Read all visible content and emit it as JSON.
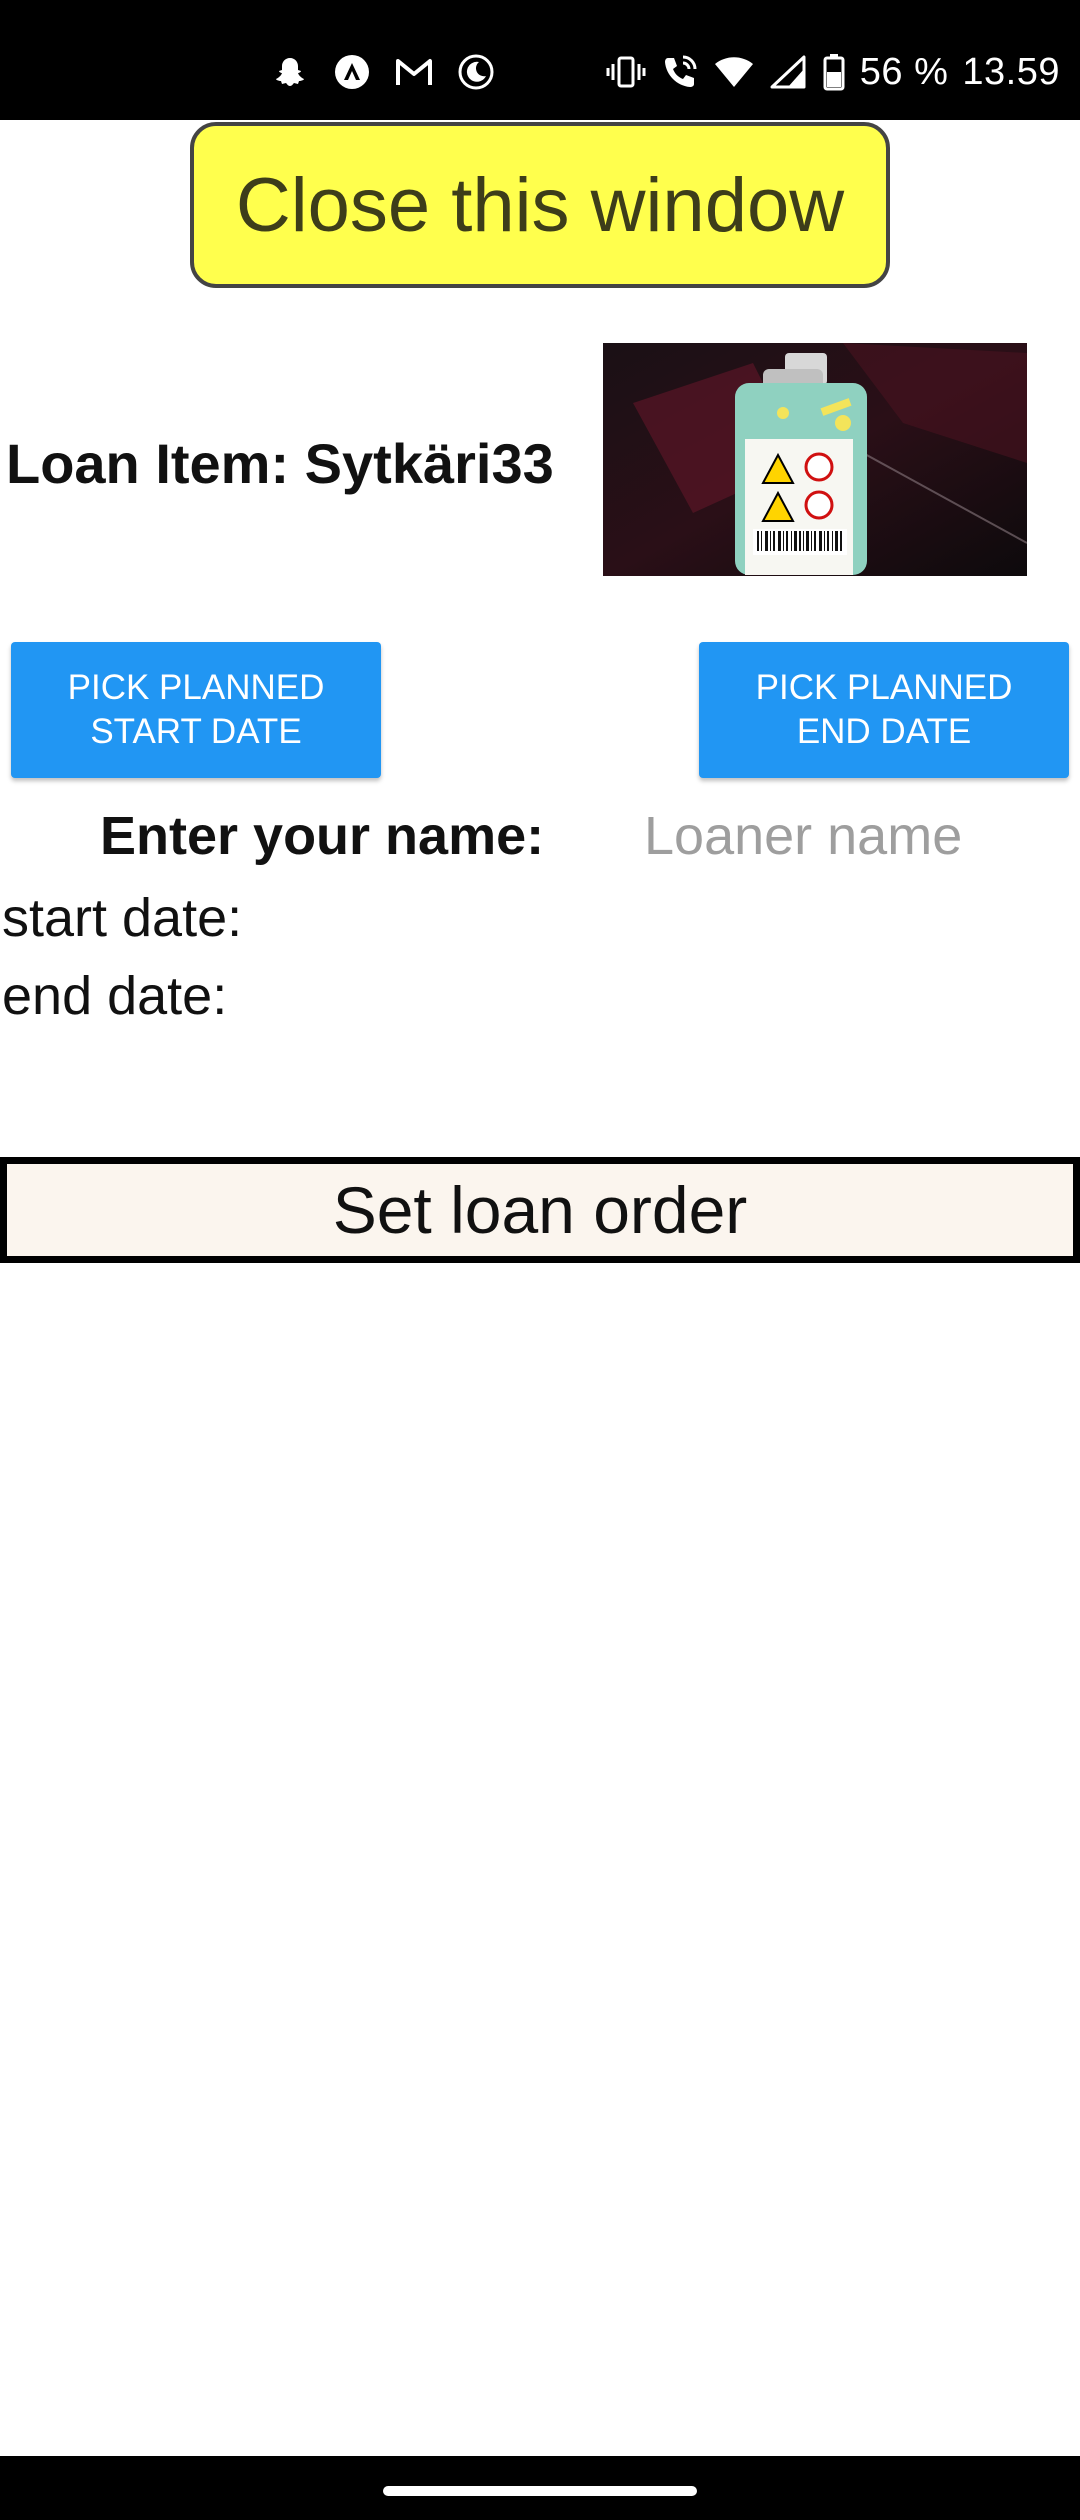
{
  "status_bar": {
    "left_icons": [
      "snapchat-icon",
      "arrow-up-circle-icon",
      "gmail-icon",
      "moon-icon"
    ],
    "right_icons": [
      "vibrate-icon",
      "wifi-call-icon",
      "wifi-icon",
      "signal-icon",
      "battery-icon"
    ],
    "battery": "56 %",
    "time": "13.59"
  },
  "close_button": {
    "label": "Close this window"
  },
  "loan_item": {
    "title": "Loan Item: Sytkäri33",
    "photo": "lighter-photo"
  },
  "buttons": {
    "start_date": "PICK PLANNED\nSTART DATE",
    "end_date": "PICK PLANNED\nEND DATE"
  },
  "name_field": {
    "label": "Enter your name:",
    "placeholder": "Loaner name",
    "value": ""
  },
  "dates": {
    "start_label": "start date:",
    "end_label": "end date:"
  },
  "set_loan_button": {
    "label": "Set loan order"
  },
  "colors": {
    "close_button_bg": "#ffff4d",
    "date_button_bg": "#2196f3",
    "set_loan_bg": "#fbf5ee"
  }
}
